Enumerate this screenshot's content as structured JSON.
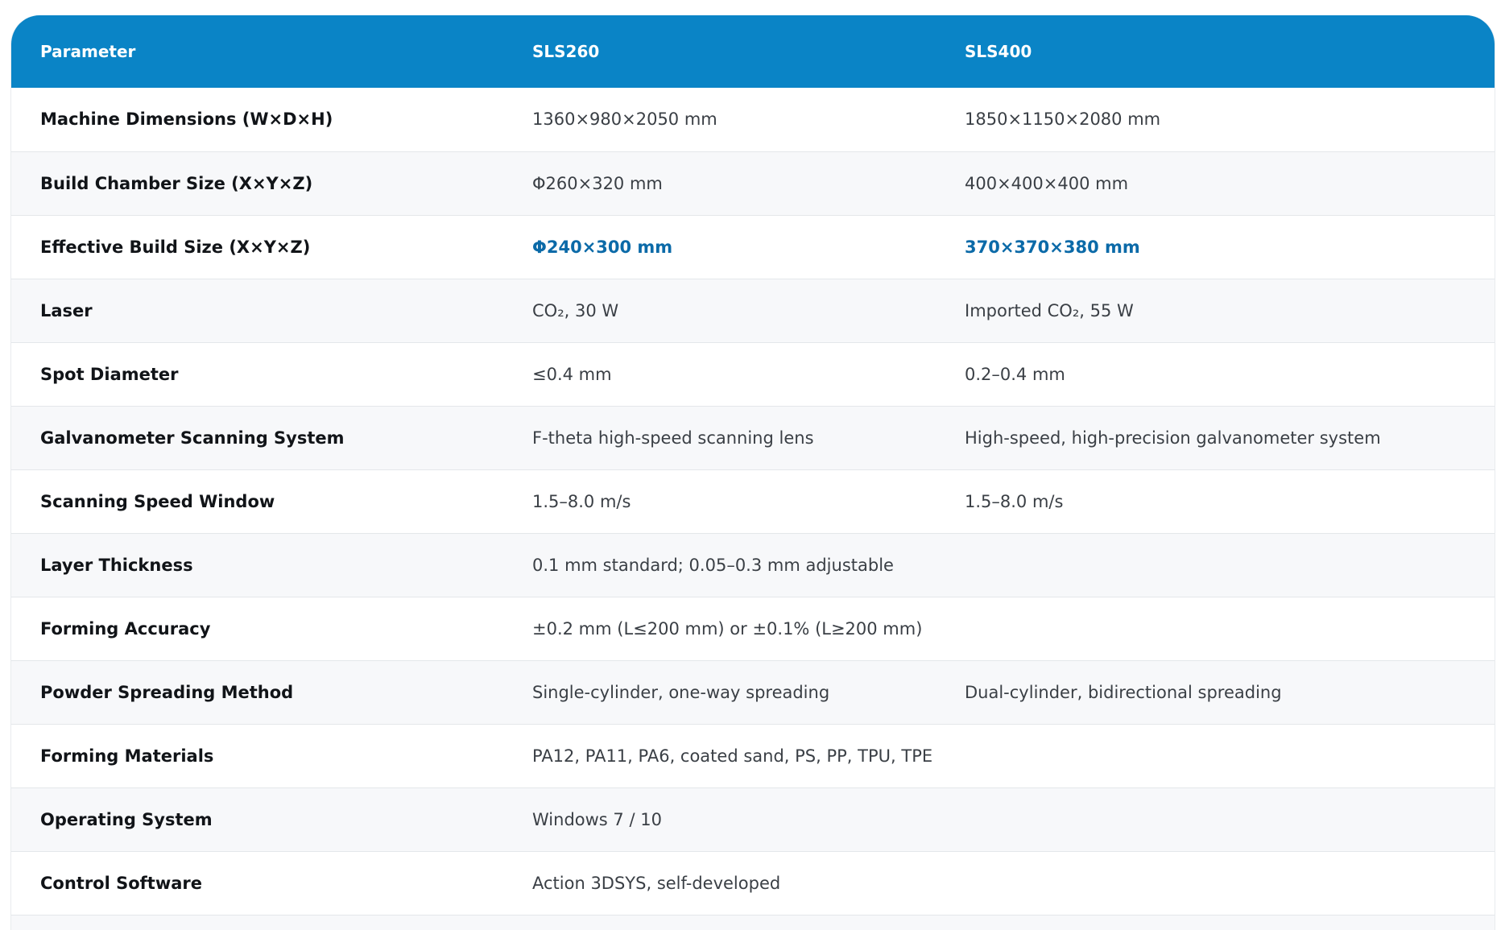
{
  "table": {
    "headers": [
      "Parameter",
      "SLS260",
      "SLS400"
    ],
    "rows": [
      {
        "param": "Machine Dimensions (W×D×H)",
        "sls260": "1360×980×2050 mm",
        "sls400": "1850×1150×2080 mm",
        "highlight": false
      },
      {
        "param": "Build Chamber Size (X×Y×Z)",
        "sls260": "Φ260×320 mm",
        "sls400": "400×400×400 mm",
        "highlight": false
      },
      {
        "param": "Effective Build Size (X×Y×Z)",
        "sls260": "Φ240×300 mm",
        "sls400": "370×370×380 mm",
        "highlight": true
      },
      {
        "param": "Laser",
        "sls260": "CO₂, 30 W",
        "sls400": "Imported CO₂, 55 W",
        "highlight": false
      },
      {
        "param": "Spot Diameter",
        "sls260": "≤0.4 mm",
        "sls400": "0.2–0.4 mm",
        "highlight": false
      },
      {
        "param": "Galvanometer Scanning System",
        "sls260": "F-theta high-speed scanning lens",
        "sls400": "High-speed, high-precision galvanometer system",
        "highlight": false
      },
      {
        "param": "Scanning Speed Window",
        "sls260": "1.5–8.0 m/s",
        "sls400": "1.5–8.0 m/s",
        "highlight": false
      },
      {
        "param": "Layer Thickness",
        "sls260": "0.1 mm standard; 0.05–0.3 mm adjustable",
        "sls400": "",
        "highlight": false
      },
      {
        "param": "Forming Accuracy",
        "sls260": "±0.2 mm (L≤200 mm) or ±0.1% (L≥200 mm)",
        "sls400": "",
        "highlight": false
      },
      {
        "param": "Powder Spreading Method",
        "sls260": "Single-cylinder, one-way spreading",
        "sls400": "Dual-cylinder, bidirectional spreading",
        "highlight": false
      },
      {
        "param": "Forming Materials",
        "sls260": "PA12, PA11, PA6, coated sand, PS, PP, TPU, TPE",
        "sls400": "",
        "highlight": false
      },
      {
        "param": "Operating System",
        "sls260": "Windows 7 / 10",
        "sls400": "",
        "highlight": false
      },
      {
        "param": "Control Software",
        "sls260": "Action 3DSYS, self-developed",
        "sls400": "",
        "highlight": false
      }
    ]
  },
  "colors": {
    "header_bg": "#0a84c6",
    "highlight_text": "#0b6aa8",
    "stripe_bg": "#f7f8fa"
  }
}
